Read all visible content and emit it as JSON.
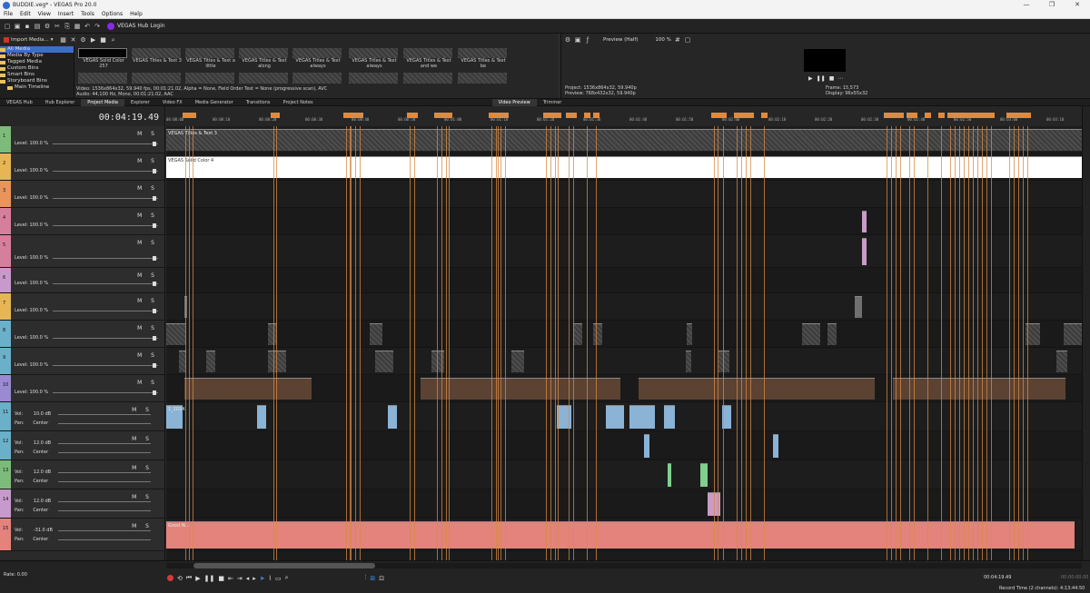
{
  "window": {
    "title": "BUDDIE.veg* - VEGAS Pro 20.0"
  },
  "menu": [
    "File",
    "Edit",
    "View",
    "Insert",
    "Tools",
    "Options",
    "Help"
  ],
  "toolbar": {
    "hub_login": "VEGAS Hub Login"
  },
  "media": {
    "import_label": "Import Media...",
    "tree": [
      "All Media",
      "Media By Type",
      "Tagged Media",
      "Custom Bins",
      "Smart Bins",
      "Storyboard Bins",
      "Main Timeline"
    ],
    "thumbs": [
      "VEGAS Solid Color 257",
      "VEGAS Titles & Text 3",
      "VEGAS Titles & Text a little",
      "VEGAS Titles & Text along",
      "VEGAS Titles & Text always",
      "VEGAS Titles & Text always",
      "VEGAS Titles & Text and we",
      "VEGAS Titles & Text be"
    ],
    "info_video": "Video: 1536x864x32, 59.940 fps, 00:01:21.02, Alpha = None, Field Order Test = None (progressive scan), AVC",
    "info_audio": "Audio: 44,100 Hz, Mono, 00:01:21.02, AAC"
  },
  "preview": {
    "mode": "Preview (Half)",
    "zoom": "100 %",
    "project": "Project:   1536x864x32, 59.940p",
    "preview": "Preview:   768x432x32, 59.940p",
    "frame_label": "Frame:",
    "frame": "15,573",
    "display_label": "Display:",
    "display": "96x55x32"
  },
  "tabs": [
    "VEGAS Hub",
    "Hub Explorer",
    "Project Media",
    "Explorer",
    "Video FX",
    "Media Generator",
    "Transitions",
    "Project Notes",
    "Video Preview",
    "Trimmer"
  ],
  "timeline": {
    "timecode": "00:04:19.49",
    "ruler_labels": [
      "00:00:00",
      "00:00:10",
      "00:00:20",
      "00:00:30",
      "00:00:40",
      "00:00:50",
      "00:01:00",
      "00:01:10",
      "00:01:20",
      "00:01:30",
      "00:01:40",
      "00:01:50",
      "00:02:00",
      "00:02:10",
      "00:02:20",
      "00:02:30",
      "00:02:40",
      "00:02:50",
      "00:03:00",
      "00:03:10"
    ],
    "video_tracks": [
      {
        "num": "1",
        "level": "Level: 100.0 %",
        "color": "#7dbb7a"
      },
      {
        "num": "2",
        "level": "Level: 100.0 %",
        "color": "#e6b654"
      },
      {
        "num": "3",
        "level": "Level: 100.0 %",
        "color": "#e8945a"
      },
      {
        "num": "4",
        "level": "Level: 100.0 %",
        "color": "#d67f9c"
      },
      {
        "num": "5",
        "level": "Level: 100.0 %",
        "color": "#d67f9c"
      },
      {
        "num": "6",
        "level": "Level: 100.0 %",
        "color": "#c89acb"
      },
      {
        "num": "7",
        "level": "Level: 100.0 %",
        "color": "#e6b654"
      },
      {
        "num": "8",
        "level": "Level: 100.0 %",
        "color": "#6ab0c8"
      },
      {
        "num": "9",
        "level": "Level: 100.0 %",
        "color": "#6ab0c8"
      },
      {
        "num": "10",
        "level": "Level: 100.0 %",
        "color": "#9a8ad1"
      }
    ],
    "audio_tracks": [
      {
        "num": "11",
        "vol": "Vol:",
        "vol_val": "10.0 dB",
        "pan": "Pan:",
        "pan_val": "Center",
        "color": "#6ab0c8"
      },
      {
        "num": "12",
        "vol": "Vol:",
        "vol_val": "12.0 dB",
        "pan": "Pan:",
        "pan_val": "Center",
        "color": "#6ab0c8"
      },
      {
        "num": "13",
        "vol": "Vol:",
        "vol_val": "12.0 dB",
        "pan": "Pan:",
        "pan_val": "Center",
        "color": "#7dbb7a"
      },
      {
        "num": "14",
        "vol": "Vol:",
        "vol_val": "12.0 dB",
        "pan": "Pan:",
        "pan_val": "Center",
        "color": "#c89acb"
      },
      {
        "num": "15",
        "vol": "Vol:",
        "vol_val": "-31.0 dB",
        "pan": "Pan:",
        "pan_val": "Center",
        "color": "#e3837b"
      }
    ],
    "clip_labels": {
      "title": "VEGAS Titles & Text 3",
      "solid": "VEGAS Solid Color 4",
      "music": "Good W...",
      "music2": "Good W...",
      "audio1": "1_2024"
    },
    "ms": "M S"
  },
  "bottom": {
    "rate": "Rate: 0.00",
    "tc": "00:04:19.49",
    "tc_end": "00:00:00.00",
    "status": "Record Time (2 channels): 4:13:44:50"
  }
}
